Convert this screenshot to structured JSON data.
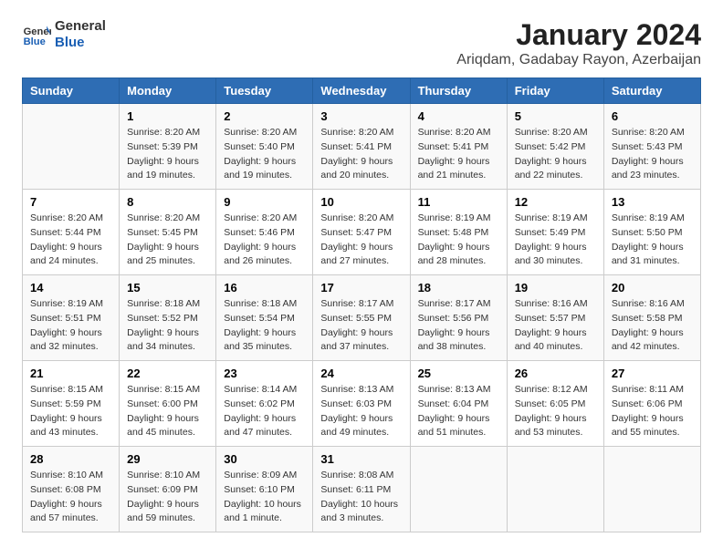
{
  "header": {
    "logo_line1": "General",
    "logo_line2": "Blue",
    "title": "January 2024",
    "subtitle": "Ariqdam, Gadabay Rayon, Azerbaijan"
  },
  "columns": [
    "Sunday",
    "Monday",
    "Tuesday",
    "Wednesday",
    "Thursday",
    "Friday",
    "Saturday"
  ],
  "weeks": [
    [
      {
        "day": "",
        "sunrise": "",
        "sunset": "",
        "daylight": ""
      },
      {
        "day": "1",
        "sunrise": "Sunrise: 8:20 AM",
        "sunset": "Sunset: 5:39 PM",
        "daylight": "Daylight: 9 hours and 19 minutes."
      },
      {
        "day": "2",
        "sunrise": "Sunrise: 8:20 AM",
        "sunset": "Sunset: 5:40 PM",
        "daylight": "Daylight: 9 hours and 19 minutes."
      },
      {
        "day": "3",
        "sunrise": "Sunrise: 8:20 AM",
        "sunset": "Sunset: 5:41 PM",
        "daylight": "Daylight: 9 hours and 20 minutes."
      },
      {
        "day": "4",
        "sunrise": "Sunrise: 8:20 AM",
        "sunset": "Sunset: 5:41 PM",
        "daylight": "Daylight: 9 hours and 21 minutes."
      },
      {
        "day": "5",
        "sunrise": "Sunrise: 8:20 AM",
        "sunset": "Sunset: 5:42 PM",
        "daylight": "Daylight: 9 hours and 22 minutes."
      },
      {
        "day": "6",
        "sunrise": "Sunrise: 8:20 AM",
        "sunset": "Sunset: 5:43 PM",
        "daylight": "Daylight: 9 hours and 23 minutes."
      }
    ],
    [
      {
        "day": "7",
        "sunrise": "Sunrise: 8:20 AM",
        "sunset": "Sunset: 5:44 PM",
        "daylight": "Daylight: 9 hours and 24 minutes."
      },
      {
        "day": "8",
        "sunrise": "Sunrise: 8:20 AM",
        "sunset": "Sunset: 5:45 PM",
        "daylight": "Daylight: 9 hours and 25 minutes."
      },
      {
        "day": "9",
        "sunrise": "Sunrise: 8:20 AM",
        "sunset": "Sunset: 5:46 PM",
        "daylight": "Daylight: 9 hours and 26 minutes."
      },
      {
        "day": "10",
        "sunrise": "Sunrise: 8:20 AM",
        "sunset": "Sunset: 5:47 PM",
        "daylight": "Daylight: 9 hours and 27 minutes."
      },
      {
        "day": "11",
        "sunrise": "Sunrise: 8:19 AM",
        "sunset": "Sunset: 5:48 PM",
        "daylight": "Daylight: 9 hours and 28 minutes."
      },
      {
        "day": "12",
        "sunrise": "Sunrise: 8:19 AM",
        "sunset": "Sunset: 5:49 PM",
        "daylight": "Daylight: 9 hours and 30 minutes."
      },
      {
        "day": "13",
        "sunrise": "Sunrise: 8:19 AM",
        "sunset": "Sunset: 5:50 PM",
        "daylight": "Daylight: 9 hours and 31 minutes."
      }
    ],
    [
      {
        "day": "14",
        "sunrise": "Sunrise: 8:19 AM",
        "sunset": "Sunset: 5:51 PM",
        "daylight": "Daylight: 9 hours and 32 minutes."
      },
      {
        "day": "15",
        "sunrise": "Sunrise: 8:18 AM",
        "sunset": "Sunset: 5:52 PM",
        "daylight": "Daylight: 9 hours and 34 minutes."
      },
      {
        "day": "16",
        "sunrise": "Sunrise: 8:18 AM",
        "sunset": "Sunset: 5:54 PM",
        "daylight": "Daylight: 9 hours and 35 minutes."
      },
      {
        "day": "17",
        "sunrise": "Sunrise: 8:17 AM",
        "sunset": "Sunset: 5:55 PM",
        "daylight": "Daylight: 9 hours and 37 minutes."
      },
      {
        "day": "18",
        "sunrise": "Sunrise: 8:17 AM",
        "sunset": "Sunset: 5:56 PM",
        "daylight": "Daylight: 9 hours and 38 minutes."
      },
      {
        "day": "19",
        "sunrise": "Sunrise: 8:16 AM",
        "sunset": "Sunset: 5:57 PM",
        "daylight": "Daylight: 9 hours and 40 minutes."
      },
      {
        "day": "20",
        "sunrise": "Sunrise: 8:16 AM",
        "sunset": "Sunset: 5:58 PM",
        "daylight": "Daylight: 9 hours and 42 minutes."
      }
    ],
    [
      {
        "day": "21",
        "sunrise": "Sunrise: 8:15 AM",
        "sunset": "Sunset: 5:59 PM",
        "daylight": "Daylight: 9 hours and 43 minutes."
      },
      {
        "day": "22",
        "sunrise": "Sunrise: 8:15 AM",
        "sunset": "Sunset: 6:00 PM",
        "daylight": "Daylight: 9 hours and 45 minutes."
      },
      {
        "day": "23",
        "sunrise": "Sunrise: 8:14 AM",
        "sunset": "Sunset: 6:02 PM",
        "daylight": "Daylight: 9 hours and 47 minutes."
      },
      {
        "day": "24",
        "sunrise": "Sunrise: 8:13 AM",
        "sunset": "Sunset: 6:03 PM",
        "daylight": "Daylight: 9 hours and 49 minutes."
      },
      {
        "day": "25",
        "sunrise": "Sunrise: 8:13 AM",
        "sunset": "Sunset: 6:04 PM",
        "daylight": "Daylight: 9 hours and 51 minutes."
      },
      {
        "day": "26",
        "sunrise": "Sunrise: 8:12 AM",
        "sunset": "Sunset: 6:05 PM",
        "daylight": "Daylight: 9 hours and 53 minutes."
      },
      {
        "day": "27",
        "sunrise": "Sunrise: 8:11 AM",
        "sunset": "Sunset: 6:06 PM",
        "daylight": "Daylight: 9 hours and 55 minutes."
      }
    ],
    [
      {
        "day": "28",
        "sunrise": "Sunrise: 8:10 AM",
        "sunset": "Sunset: 6:08 PM",
        "daylight": "Daylight: 9 hours and 57 minutes."
      },
      {
        "day": "29",
        "sunrise": "Sunrise: 8:10 AM",
        "sunset": "Sunset: 6:09 PM",
        "daylight": "Daylight: 9 hours and 59 minutes."
      },
      {
        "day": "30",
        "sunrise": "Sunrise: 8:09 AM",
        "sunset": "Sunset: 6:10 PM",
        "daylight": "Daylight: 10 hours and 1 minute."
      },
      {
        "day": "31",
        "sunrise": "Sunrise: 8:08 AM",
        "sunset": "Sunset: 6:11 PM",
        "daylight": "Daylight: 10 hours and 3 minutes."
      },
      {
        "day": "",
        "sunrise": "",
        "sunset": "",
        "daylight": ""
      },
      {
        "day": "",
        "sunrise": "",
        "sunset": "",
        "daylight": ""
      },
      {
        "day": "",
        "sunrise": "",
        "sunset": "",
        "daylight": ""
      }
    ]
  ]
}
